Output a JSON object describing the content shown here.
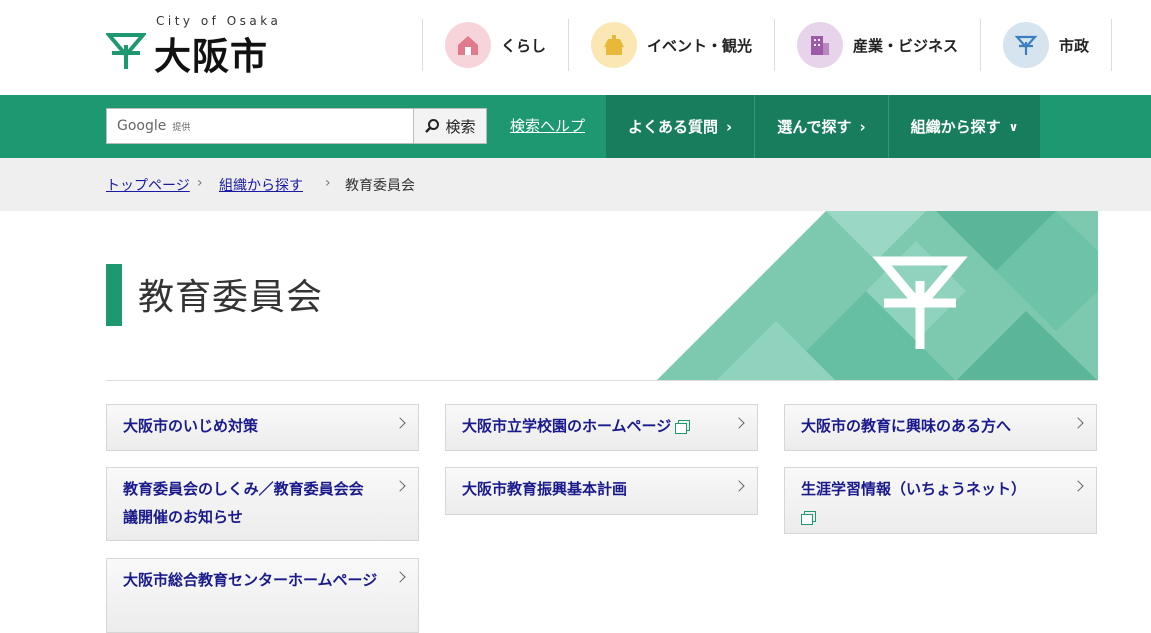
{
  "header": {
    "logo_sub": "City of Osaka",
    "logo_name": "大阪市",
    "nav": [
      {
        "label": "くらし",
        "icon": "house-icon",
        "color": "#f6d4da"
      },
      {
        "label": "イベント・観光",
        "icon": "castle-icon",
        "color": "#fbe7b4"
      },
      {
        "label": "産業・ビジネス",
        "icon": "building-icon",
        "color": "#e8d4ea"
      },
      {
        "label": "市政",
        "icon": "city-emblem-icon",
        "color": "#d6e4ef"
      }
    ]
  },
  "search": {
    "google_label": "Google",
    "provided_label": "提供",
    "button_label": "検索",
    "help_label": "検索ヘルプ"
  },
  "gnav": [
    {
      "label": "よくある質問"
    },
    {
      "label": "選んで探す"
    },
    {
      "label": "組織から探す"
    }
  ],
  "breadcrumb": {
    "home": "トップページ",
    "parent": "組織から探す",
    "current": "教育委員会"
  },
  "page": {
    "title": "教育委員会"
  },
  "colors": {
    "brand_green": "#1e9870",
    "link_text": "#1a1a8c"
  },
  "links": [
    {
      "label": "大阪市のいじめ対策",
      "external": false
    },
    {
      "label": "教育委員会のしくみ／教育委員会会議開催のお知らせ",
      "external": false
    },
    {
      "label": "大阪市総合教育センターホームページ",
      "external": false
    },
    {
      "label": "大阪市立学校園のホームページ",
      "external": true
    },
    {
      "label": "大阪市教育振興基本計画",
      "external": false
    },
    {
      "label": "大阪市の教育に興味のある方へ",
      "external": false
    },
    {
      "label": "生涯学習情報（いちょうネット）",
      "external": true
    }
  ]
}
